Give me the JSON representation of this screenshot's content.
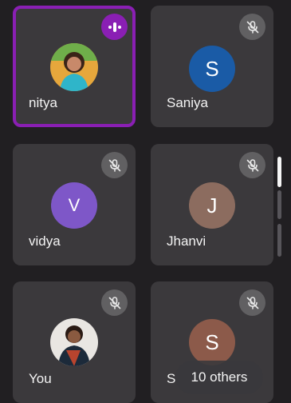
{
  "participants": [
    {
      "name": "nitya",
      "avatar": "photo",
      "status": "speaking"
    },
    {
      "name": "Saniya",
      "initial": "S",
      "avatar_color": "#1a5ba6",
      "status": "muted"
    },
    {
      "name": "vidya",
      "initial": "V",
      "avatar_color": "#7e57c8",
      "status": "muted"
    },
    {
      "name": "Jhanvi",
      "initial": "J",
      "avatar_color": "#8c6c5f",
      "status": "muted"
    },
    {
      "name": "You",
      "avatar": "photo",
      "status": "muted"
    },
    {
      "name": "S",
      "initial": "S",
      "avatar_color": "#8c5a4a",
      "status": "muted"
    }
  ],
  "overlay": {
    "others_label": "10 others"
  },
  "colors": {
    "speaking_accent": "#8a1fb4",
    "tile_bg": "#3b393c",
    "mute_badge": "#616062"
  },
  "icons": {
    "speaking": "audio-waves-icon",
    "muted": "mic-off-icon"
  }
}
